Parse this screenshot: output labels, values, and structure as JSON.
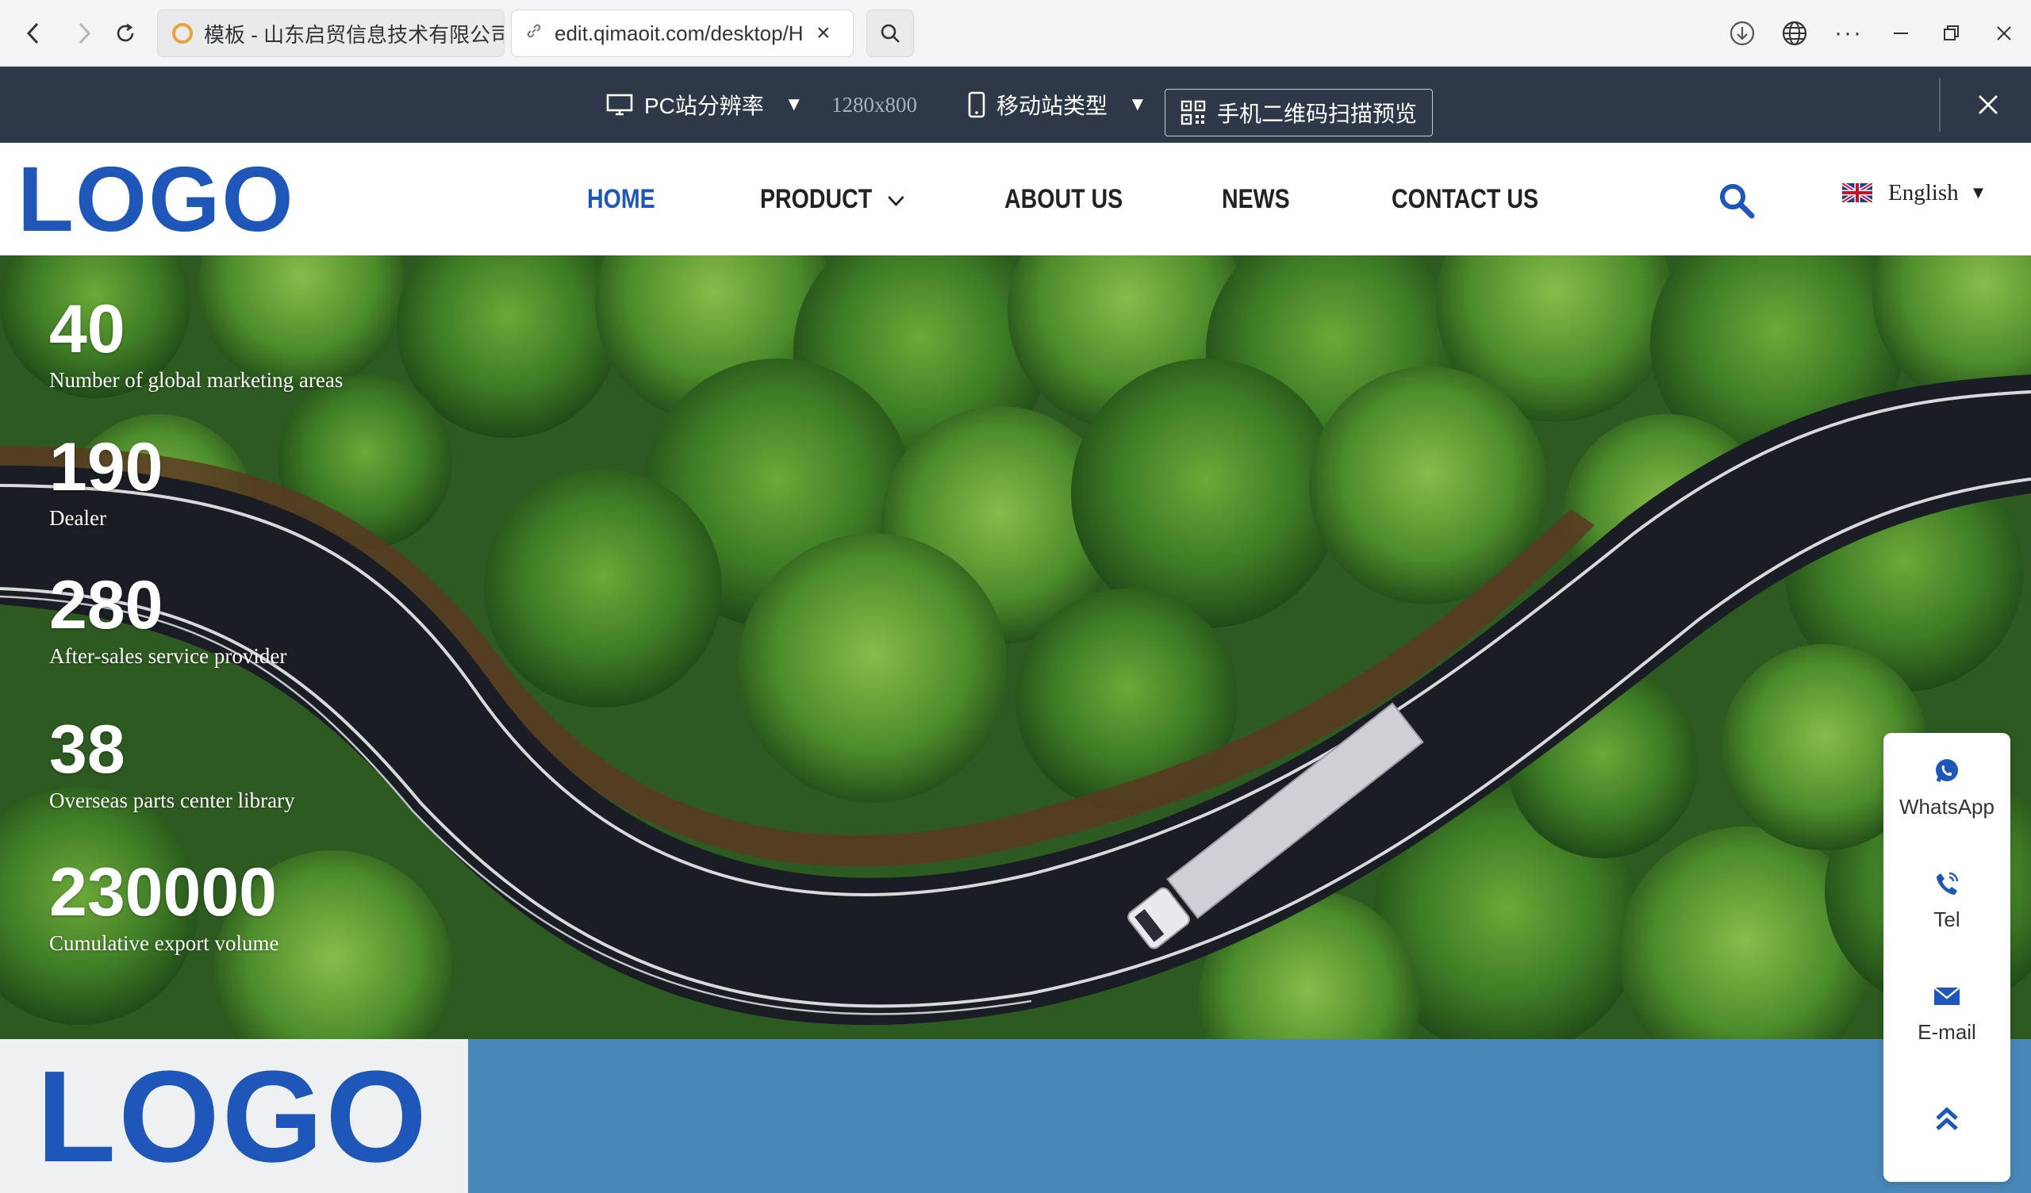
{
  "browser": {
    "tabs": [
      {
        "title": "模板 - 山东启贸信息技术有限公司",
        "active": false
      },
      {
        "title": "edit.qimaoit.com/desktop/H",
        "active": true
      }
    ]
  },
  "editor": {
    "pc_resolution_label": "PC站分辨率",
    "resolution_value": "1280x800",
    "mobile_type_label": "移动站类型",
    "qr_preview_label": "手机二维码扫描预览"
  },
  "header": {
    "logo": "LOGO",
    "nav": [
      {
        "label": "HOME",
        "active": true
      },
      {
        "label": "PRODUCT",
        "has_dropdown": true
      },
      {
        "label": "ABOUT US"
      },
      {
        "label": "NEWS"
      },
      {
        "label": "CONTACT US"
      }
    ],
    "language": "English"
  },
  "hero": {
    "stats": [
      {
        "value": "40",
        "label": "Number of global marketing areas"
      },
      {
        "value": "190",
        "label": "Dealer"
      },
      {
        "value": "280",
        "label": "After-sales service provider"
      },
      {
        "value": "38",
        "label": "Overseas parts center library"
      },
      {
        "value": "230000",
        "label": "Cumulative export volume"
      }
    ]
  },
  "footer": {
    "logo": "LOGO"
  },
  "contact_float": {
    "items": [
      {
        "label": "WhatsApp",
        "icon": "whatsapp-icon"
      },
      {
        "label": "Tel",
        "icon": "phone-icon"
      },
      {
        "label": "E-mail",
        "icon": "mail-icon"
      }
    ],
    "back_to_top_icon": "double-chevron-up-icon"
  },
  "colors": {
    "brand_blue": "#1f57b8",
    "editor_bar": "#2e3849",
    "footer_band": "#4a87b9",
    "float_icon": "#1f57b8"
  }
}
